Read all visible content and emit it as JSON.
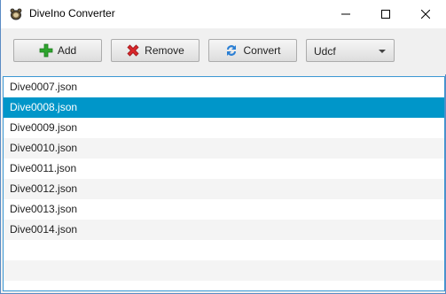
{
  "window": {
    "title": "DiveIno Converter",
    "app_icon": "turtle-icon"
  },
  "toolbar": {
    "add_label": "Add",
    "remove_label": "Remove",
    "convert_label": "Convert",
    "format_select": {
      "value": "Udcf"
    }
  },
  "file_list": {
    "items": [
      {
        "label": "Dive0007.json",
        "selected": false
      },
      {
        "label": "Dive0008.json",
        "selected": true
      },
      {
        "label": "Dive0009.json",
        "selected": false
      },
      {
        "label": "Dive0010.json",
        "selected": false
      },
      {
        "label": "Dive0011.json",
        "selected": false
      },
      {
        "label": "Dive0012.json",
        "selected": false
      },
      {
        "label": "Dive0013.json",
        "selected": false
      },
      {
        "label": "Dive0014.json",
        "selected": false
      }
    ],
    "empty_rows": 2
  },
  "colors": {
    "selection": "#0096c9",
    "list_border": "#3c97d3",
    "add_icon": "#2ea52e",
    "remove_icon": "#d8262a",
    "convert_icon": "#2b7fd4"
  }
}
